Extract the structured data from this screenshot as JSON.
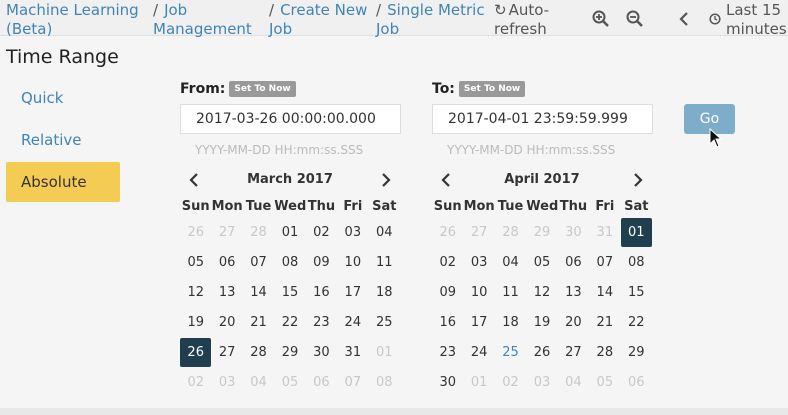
{
  "breadcrumb": [
    {
      "label": "Machine Learning (Beta)"
    },
    {
      "label": "Job Management"
    },
    {
      "label": "Create New Job"
    },
    {
      "label": "Single Metric Job"
    }
  ],
  "toolbar": {
    "auto_refresh": "Auto-refresh",
    "last_range": "Last 15 minutes"
  },
  "page_title": "Time Range",
  "modes": [
    {
      "label": "Quick",
      "active": false
    },
    {
      "label": "Relative",
      "active": false
    },
    {
      "label": "Absolute",
      "active": true
    }
  ],
  "from": {
    "label": "From:",
    "set_to_now": "Set To Now",
    "value": "2017-03-26 00:00:00.000",
    "format_hint": "YYYY-MM-DD HH:mm:ss.SSS"
  },
  "to": {
    "label": "To:",
    "set_to_now": "Set To Now",
    "value": "2017-04-01 23:59:59.999",
    "format_hint": "YYYY-MM-DD HH:mm:ss.SSS"
  },
  "go_label": "Go",
  "weekdays": [
    "Sun",
    "Mon",
    "Tue",
    "Wed",
    "Thu",
    "Fri",
    "Sat"
  ],
  "calendars": [
    {
      "month": "March 2017",
      "weeks": [
        [
          {
            "d": "26",
            "m": true
          },
          {
            "d": "27",
            "m": true
          },
          {
            "d": "28",
            "m": true
          },
          {
            "d": "01"
          },
          {
            "d": "02"
          },
          {
            "d": "03"
          },
          {
            "d": "04"
          }
        ],
        [
          {
            "d": "05"
          },
          {
            "d": "06"
          },
          {
            "d": "07"
          },
          {
            "d": "08"
          },
          {
            "d": "09"
          },
          {
            "d": "10"
          },
          {
            "d": "11"
          }
        ],
        [
          {
            "d": "12"
          },
          {
            "d": "13"
          },
          {
            "d": "14"
          },
          {
            "d": "15"
          },
          {
            "d": "16"
          },
          {
            "d": "17"
          },
          {
            "d": "18"
          }
        ],
        [
          {
            "d": "19"
          },
          {
            "d": "20"
          },
          {
            "d": "21"
          },
          {
            "d": "22"
          },
          {
            "d": "23"
          },
          {
            "d": "24"
          },
          {
            "d": "25"
          }
        ],
        [
          {
            "d": "26",
            "sel": true
          },
          {
            "d": "27"
          },
          {
            "d": "28"
          },
          {
            "d": "29"
          },
          {
            "d": "30"
          },
          {
            "d": "31"
          },
          {
            "d": "01",
            "m": true
          }
        ],
        [
          {
            "d": "02",
            "m": true
          },
          {
            "d": "03",
            "m": true
          },
          {
            "d": "04",
            "m": true
          },
          {
            "d": "05",
            "m": true
          },
          {
            "d": "06",
            "m": true
          },
          {
            "d": "07",
            "m": true
          },
          {
            "d": "08",
            "m": true
          }
        ]
      ]
    },
    {
      "month": "April 2017",
      "weeks": [
        [
          {
            "d": "26",
            "m": true
          },
          {
            "d": "27",
            "m": true
          },
          {
            "d": "28",
            "m": true
          },
          {
            "d": "29",
            "m": true
          },
          {
            "d": "30",
            "m": true
          },
          {
            "d": "31",
            "m": true
          },
          {
            "d": "01",
            "sel": true
          }
        ],
        [
          {
            "d": "02"
          },
          {
            "d": "03"
          },
          {
            "d": "04"
          },
          {
            "d": "05"
          },
          {
            "d": "06"
          },
          {
            "d": "07"
          },
          {
            "d": "08"
          }
        ],
        [
          {
            "d": "09"
          },
          {
            "d": "10"
          },
          {
            "d": "11"
          },
          {
            "d": "12"
          },
          {
            "d": "13"
          },
          {
            "d": "14"
          },
          {
            "d": "15"
          }
        ],
        [
          {
            "d": "16"
          },
          {
            "d": "17"
          },
          {
            "d": "18"
          },
          {
            "d": "19"
          },
          {
            "d": "20"
          },
          {
            "d": "21"
          },
          {
            "d": "22"
          }
        ],
        [
          {
            "d": "23"
          },
          {
            "d": "24"
          },
          {
            "d": "25",
            "today": true
          },
          {
            "d": "26"
          },
          {
            "d": "27"
          },
          {
            "d": "28"
          },
          {
            "d": "29"
          }
        ],
        [
          {
            "d": "30"
          },
          {
            "d": "01",
            "m": true
          },
          {
            "d": "02",
            "m": true
          },
          {
            "d": "03",
            "m": true
          },
          {
            "d": "04",
            "m": true
          },
          {
            "d": "05",
            "m": true
          },
          {
            "d": "06",
            "m": true
          }
        ]
      ]
    }
  ],
  "colors": {
    "link": "#3f84b8",
    "active_mode": "#f5cc53",
    "selected_day": "#1f3f4f",
    "go_button": "#7eadc9"
  }
}
